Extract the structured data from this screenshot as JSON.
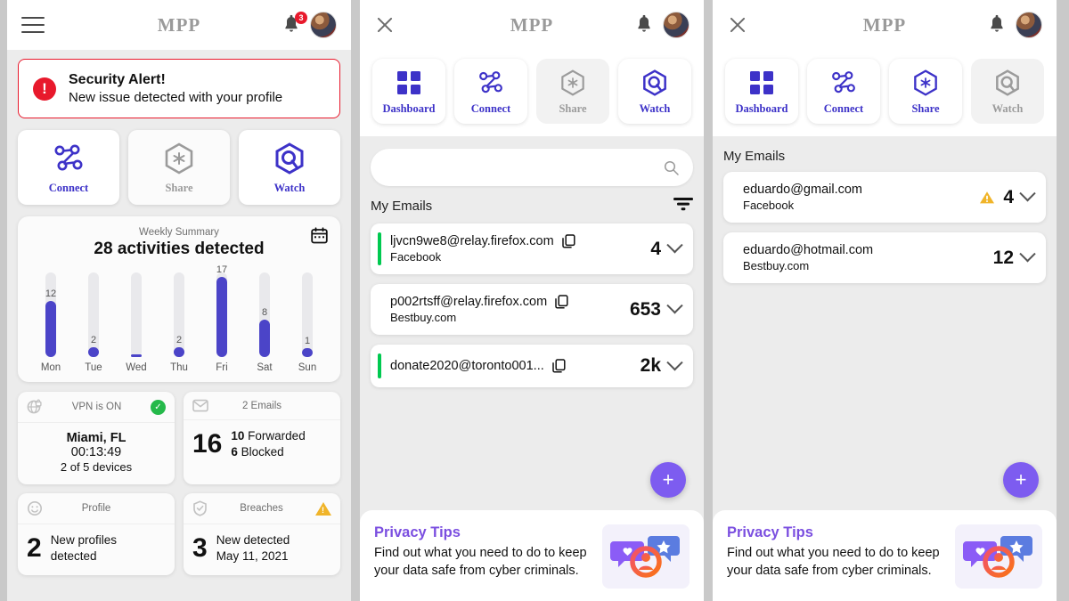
{
  "app": {
    "brand": "MPP"
  },
  "panel1": {
    "header": {
      "menu_icon": "hamburger-icon",
      "bell_icon": "bell-icon",
      "notification_count": "3",
      "avatar": "user-avatar"
    },
    "alert": {
      "icon": "exclamation-icon",
      "title": "Security Alert!",
      "message": "New issue detected with your profile",
      "color": "#e8192c"
    },
    "actions": [
      {
        "label": "Connect",
        "icon": "connect-nodes-icon",
        "state": "active"
      },
      {
        "label": "Share",
        "icon": "share-hex-icon",
        "state": "disabled"
      },
      {
        "label": "Watch",
        "icon": "watch-hex-icon",
        "state": "active"
      }
    ],
    "chart_card": {
      "subtitle": "Weekly Summary",
      "title": "28 activities detected",
      "calendar_icon": "calendar-icon"
    },
    "stats": [
      {
        "id": "vpn",
        "icon": "globe-lock-icon",
        "title": "VPN is ON",
        "status_icon": "check-circle-icon",
        "status_color": "#25b94a",
        "line1": "Miami, FL",
        "line2": "00:13:49",
        "line3": "2 of 5 devices"
      },
      {
        "id": "emails",
        "icon": "envelope-icon",
        "title": "2 Emails",
        "big": "16",
        "detail1_num": "10",
        "detail1_txt": "Forwarded",
        "detail2_num": "6",
        "detail2_txt": "Blocked"
      },
      {
        "id": "profile",
        "icon": "smiley-icon",
        "title": "Profile",
        "big": "2",
        "detail_line1": "New profiles",
        "detail_line2": "detected"
      },
      {
        "id": "breaches",
        "icon": "shield-check-icon",
        "title": "Breaches",
        "status_icon": "warning-triangle-icon",
        "status_color": "#f0b429",
        "big": "3",
        "detail_line1": "New detected",
        "detail_line2": "May 11, 2021"
      }
    ]
  },
  "panel2": {
    "header": {
      "close_icon": "close-icon",
      "bell_icon": "bell-icon",
      "avatar": "user-avatar"
    },
    "nav": [
      {
        "label": "Dashboard",
        "icon": "grid-icon",
        "state": "active"
      },
      {
        "label": "Connect",
        "icon": "connect-nodes-icon",
        "state": "active"
      },
      {
        "label": "Share",
        "icon": "share-hex-icon",
        "state": "disabled"
      },
      {
        "label": "Watch",
        "icon": "watch-hex-icon",
        "state": "active"
      }
    ],
    "search": {
      "value": "",
      "placeholder": "",
      "icon": "search-icon"
    },
    "list_title": "My Emails",
    "filter_icon": "filter-icon",
    "emails": [
      {
        "address": "ljvcn9we8@relay.firefox.com",
        "site": "Facebook",
        "count": "4",
        "accent": true,
        "copy_icon": "copy-icon",
        "chevron": "chevron-down-icon"
      },
      {
        "address": "p002rtsff@relay.firefox.com",
        "site": "Bestbuy.com",
        "count": "653",
        "accent": false,
        "copy_icon": "copy-icon",
        "chevron": "chevron-down-icon"
      },
      {
        "address": "donate2020@toronto001...",
        "site": "",
        "count": "2k",
        "accent": true,
        "copy_icon": "copy-icon",
        "chevron": "chevron-down-icon"
      }
    ],
    "fab": {
      "label": "+",
      "icon": "plus-icon",
      "color": "#7d5cf0"
    },
    "tips": {
      "title": "Privacy Tips",
      "body": "Find out what you need to do to keep your data safe from cyber criminals.",
      "image": "privacy-illustration"
    }
  },
  "panel3": {
    "header": {
      "close_icon": "close-icon",
      "bell_icon": "bell-icon",
      "avatar": "user-avatar"
    },
    "nav": [
      {
        "label": "Dashboard",
        "icon": "grid-icon",
        "state": "active"
      },
      {
        "label": "Connect",
        "icon": "connect-nodes-icon",
        "state": "active"
      },
      {
        "label": "Share",
        "icon": "share-hex-icon",
        "state": "active"
      },
      {
        "label": "Watch",
        "icon": "watch-hex-icon",
        "state": "disabled"
      }
    ],
    "list_title": "My Emails",
    "emails": [
      {
        "address": "eduardo@gmail.com",
        "site": "Facebook",
        "count": "4",
        "warn": true,
        "chevron": "chevron-down-icon"
      },
      {
        "address": "eduardo@hotmail.com",
        "site": "Bestbuy.com",
        "count": "12",
        "warn": false,
        "chevron": "chevron-down-icon"
      }
    ],
    "fab": {
      "label": "+",
      "icon": "plus-icon",
      "color": "#7d5cf0"
    },
    "tips": {
      "title": "Privacy Tips",
      "body": "Find out what you need to do to keep your data safe from cyber criminals.",
      "image": "privacy-illustration"
    }
  },
  "chart_data": {
    "type": "bar",
    "title": "28 activities detected",
    "subtitle": "Weekly Summary",
    "categories": [
      "Mon",
      "Tue",
      "Wed",
      "Thu",
      "Fri",
      "Sat",
      "Sun"
    ],
    "values": [
      12,
      2,
      0,
      2,
      17,
      8,
      1
    ],
    "xlabel": "",
    "ylabel": "",
    "ylim": [
      0,
      18
    ],
    "grid": false,
    "legend": "none",
    "bar_color": "#4b44c8",
    "track_color": "#e9e9ec",
    "total": 28
  }
}
